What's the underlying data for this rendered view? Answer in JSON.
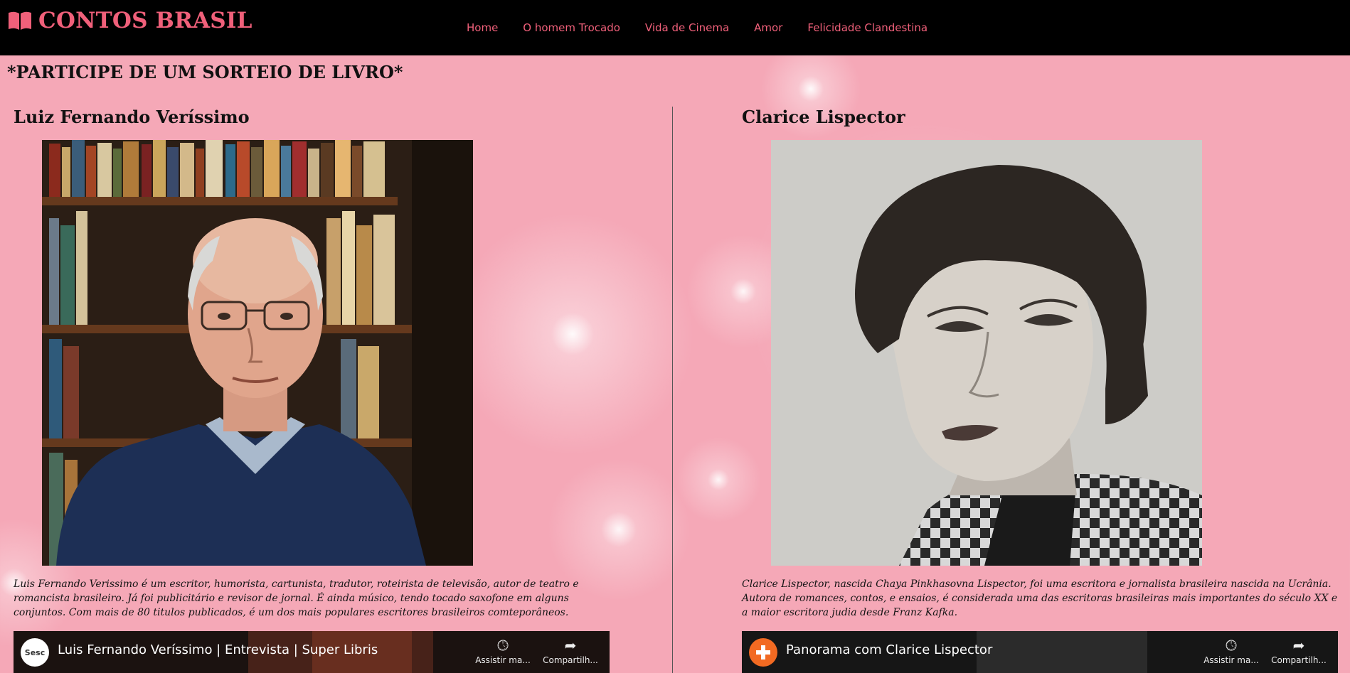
{
  "header": {
    "logo_text": "CONTOS BRASIL",
    "nav": [
      "Home",
      "O homem Trocado",
      "Vida de Cinema",
      "Amor",
      "Felicidade Clandestina"
    ]
  },
  "banner": "*PARTICIPE DE UM SORTEIO DE LIVRO*",
  "authors": [
    {
      "name": "Luiz Fernando Veríssimo",
      "bio": "Luis Fernando Verissimo é um escritor, humorista, cartunista, tradutor, roteirista de televisão, autor de teatro e romancista brasileiro. Já foi publicitário e revisor de jornal. É ainda músico, tendo tocado saxofone em alguns conjuntos. Com mais de 80 titulos publicados, é um dos mais populares escritores brasileiros comteporâneos.",
      "video_title": "Luis Fernando Veríssimo | Entrevista | Super Libris",
      "channel_icon": "sesc-logo-icon",
      "channel_text": "Sesc",
      "watch_label": "Assistir ma...",
      "share_label": "Compartilh..."
    },
    {
      "name": "Clarice Lispector",
      "bio": "Clarice Lispector, nascida Chaya Pinkhasovna Lispector, foi uma escritora e jornalista brasileira nascida na Ucrânia. Autora de romances, contos, e ensaios, é considerada uma das escritoras brasileiras mais importantes do século XX e a maior escritora judia desde Franz Kafka.",
      "video_title": "Panorama com Clarice Lispector",
      "channel_icon": "cross-logo-icon",
      "watch_label": "Assistir ma...",
      "share_label": "Compartilh..."
    }
  ],
  "colors": {
    "accent": "#f0607a",
    "background": "#f5a8b7",
    "topbar": "#000000"
  }
}
